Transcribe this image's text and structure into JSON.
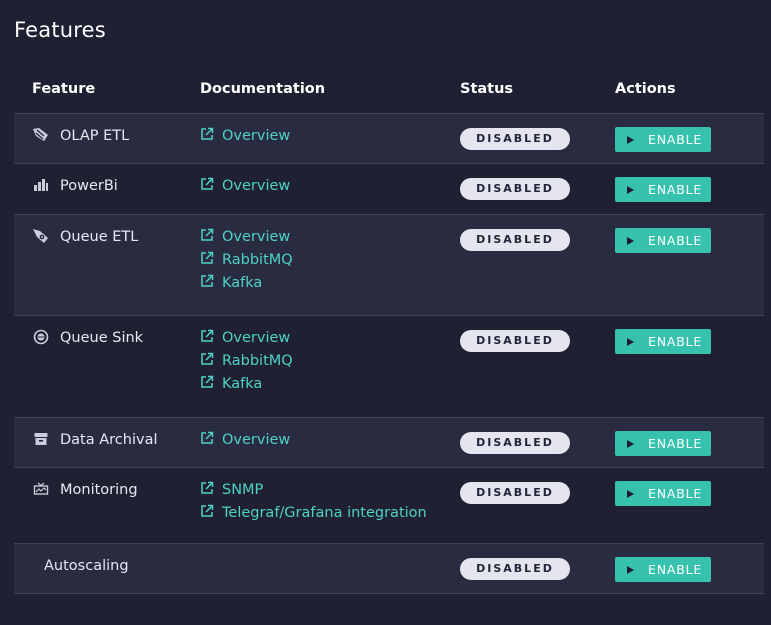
{
  "page": {
    "title": "Features"
  },
  "table": {
    "headers": {
      "feature": "Feature",
      "documentation": "Documentation",
      "status": "Status",
      "actions": "Actions"
    },
    "rows": [
      {
        "feature": "OLAP ETL",
        "icon": "olap-etl-icon",
        "links": [
          "Overview"
        ],
        "status": "DISABLED",
        "action": "ENABLE"
      },
      {
        "feature": "PowerBi",
        "icon": "powerbi-icon",
        "links": [
          "Overview"
        ],
        "status": "DISABLED",
        "action": "ENABLE"
      },
      {
        "feature": "Queue ETL",
        "icon": "queue-etl-icon",
        "links": [
          "Overview",
          "RabbitMQ",
          "Kafka"
        ],
        "status": "DISABLED",
        "action": "ENABLE"
      },
      {
        "feature": "Queue Sink",
        "icon": "queue-sink-icon",
        "links": [
          "Overview",
          "RabbitMQ",
          "Kafka"
        ],
        "status": "DISABLED",
        "action": "ENABLE"
      },
      {
        "feature": "Data Archival",
        "icon": "archive-icon",
        "links": [
          "Overview"
        ],
        "status": "DISABLED",
        "action": "ENABLE"
      },
      {
        "feature": "Monitoring",
        "icon": "monitoring-icon",
        "links": [
          "SNMP",
          "Telegraf/Grafana integration"
        ],
        "status": "DISABLED",
        "action": "ENABLE"
      },
      {
        "feature": "Autoscaling",
        "icon": "",
        "links": [],
        "status": "DISABLED",
        "action": "ENABLE"
      }
    ]
  },
  "colors": {
    "background": "#1f2133",
    "row_shaded": "#292c40",
    "link": "#4fd1c5",
    "button": "#36c2ad",
    "badge": "#e4e5ee"
  }
}
